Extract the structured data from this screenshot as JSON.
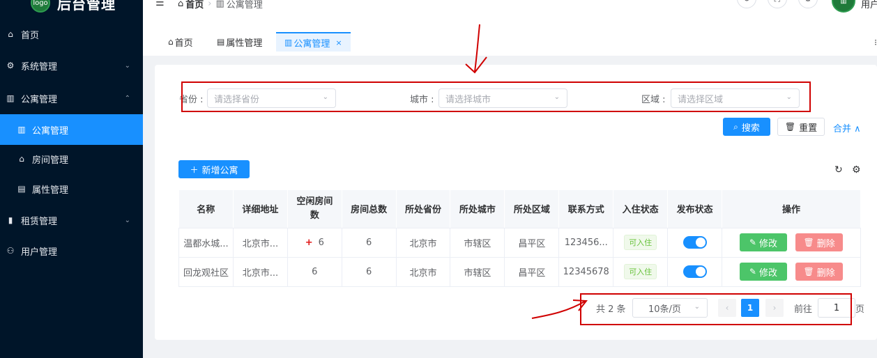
{
  "sidebar": {
    "logo_badge": "logo",
    "title": "后台管理",
    "items": [
      {
        "label": "首页",
        "icon": "home-icon"
      },
      {
        "label": "系统管理",
        "icon": "gear-icon"
      },
      {
        "label": "公寓管理",
        "icon": "building-icon"
      },
      {
        "label": "公寓管理",
        "icon": "building-icon"
      },
      {
        "label": "房间管理",
        "icon": "house-icon"
      },
      {
        "label": "属性管理",
        "icon": "clipboard-icon"
      },
      {
        "label": "租赁管理",
        "icon": "chart-icon"
      },
      {
        "label": "用户管理",
        "icon": "user-icon"
      }
    ]
  },
  "header": {
    "breadcrumb": [
      "首页",
      "公寓管理"
    ],
    "user_name": "用户"
  },
  "tabs": [
    {
      "label": "首页"
    },
    {
      "label": "属性管理"
    },
    {
      "label": "公寓管理",
      "close": "×"
    }
  ],
  "search": {
    "province_label": "省份 :",
    "province_placeholder": "请选择省份",
    "city_label": "城市 :",
    "city_placeholder": "请选择城市",
    "district_label": "区域 :",
    "district_placeholder": "请选择区域",
    "search_btn": "搜索",
    "reset_btn": "重置",
    "collapse_link": "合并 ∧"
  },
  "toolbar": {
    "add_btn": "新增公寓"
  },
  "table": {
    "headers": [
      "名称",
      "详细地址",
      "空闲房间数",
      "房间总数",
      "所处省份",
      "所处城市",
      "所处区域",
      "联系方式",
      "入住状态",
      "发布状态",
      "操作"
    ],
    "rows": [
      {
        "name": "温都水城...",
        "address": "北京市...",
        "free": "6",
        "total": "6",
        "province": "北京市",
        "city": "市辖区",
        "district": "昌平区",
        "phone": "123456...",
        "checkin": "可入住",
        "edit": "修改",
        "del": "删除"
      },
      {
        "name": "回龙观社区",
        "address": "北京市...",
        "free": "6",
        "total": "6",
        "province": "北京市",
        "city": "市辖区",
        "district": "昌平区",
        "phone": "12345678",
        "checkin": "可入住",
        "edit": "修改",
        "del": "删除"
      }
    ]
  },
  "pager": {
    "total": "共 2 条",
    "page_size": "10条/页",
    "prev": "‹",
    "current": "1",
    "next": "›",
    "goto_label": "前往",
    "goto_value": "1",
    "page_label": "页"
  },
  "annotation_color": "#d00000"
}
